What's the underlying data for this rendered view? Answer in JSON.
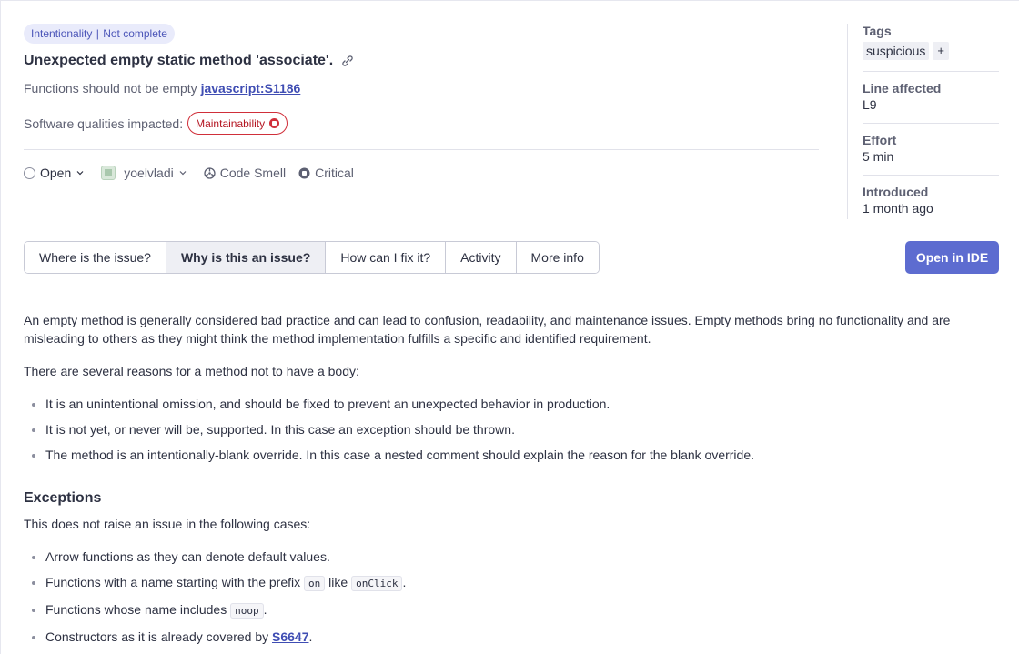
{
  "issue": {
    "attribute_badge": "Intentionality",
    "completeness_badge": "Not complete",
    "title": "Unexpected empty static method 'associate'.",
    "rule_text": "Functions should not be empty",
    "rule_key": "javascript:S1186",
    "qualities_label": "Software qualities impacted:",
    "quality": "Maintainability",
    "status": "Open",
    "assignee": "yoelvladi",
    "type": "Code Smell",
    "severity": "Critical"
  },
  "sidebar": {
    "tags_label": "Tags",
    "tag": "suspicious",
    "tag_add": "+",
    "line_label": "Line affected",
    "line_value": "L9",
    "effort_label": "Effort",
    "effort_value": "5 min",
    "introduced_label": "Introduced",
    "introduced_value": "1 month ago"
  },
  "tabs": [
    {
      "label": "Where is the issue?"
    },
    {
      "label": "Why is this an issue?"
    },
    {
      "label": "How can I fix it?"
    },
    {
      "label": "Activity"
    },
    {
      "label": "More info"
    }
  ],
  "open_ide": "Open in IDE",
  "content": {
    "para1": "An empty method is generally considered bad practice and can lead to confusion, readability, and maintenance issues. Empty methods bring no functionality and are misleading to others as they might think the method implementation fulfills a specific and identified requirement.",
    "para2": "There are several reasons for a method not to have a body:",
    "reasons": [
      "It is an unintentional omission, and should be fixed to prevent an unexpected behavior in production.",
      "It is not yet, or never will be, supported. In this case an exception should be thrown.",
      "The method is an intentionally-blank override. In this case a nested comment should explain the reason for the blank override."
    ],
    "exceptions_heading": "Exceptions",
    "exceptions_intro": "This does not raise an issue in the following cases:",
    "exc1": "Arrow functions as they can denote default values.",
    "exc2_a": "Functions with a name starting with the prefix",
    "exc2_code1": "on",
    "exc2_b": "like",
    "exc2_code2": "onClick",
    "exc2_c": ".",
    "exc3_a": "Functions whose name includes",
    "exc3_code": "noop",
    "exc3_b": ".",
    "exc4_a": "Constructors as it is already covered by",
    "exc4_link": "S6647",
    "exc4_b": "."
  },
  "colors": {
    "accent": "#5d6cd0",
    "danger": "#d02f3a",
    "badge_bg": "#e9ebfb"
  }
}
